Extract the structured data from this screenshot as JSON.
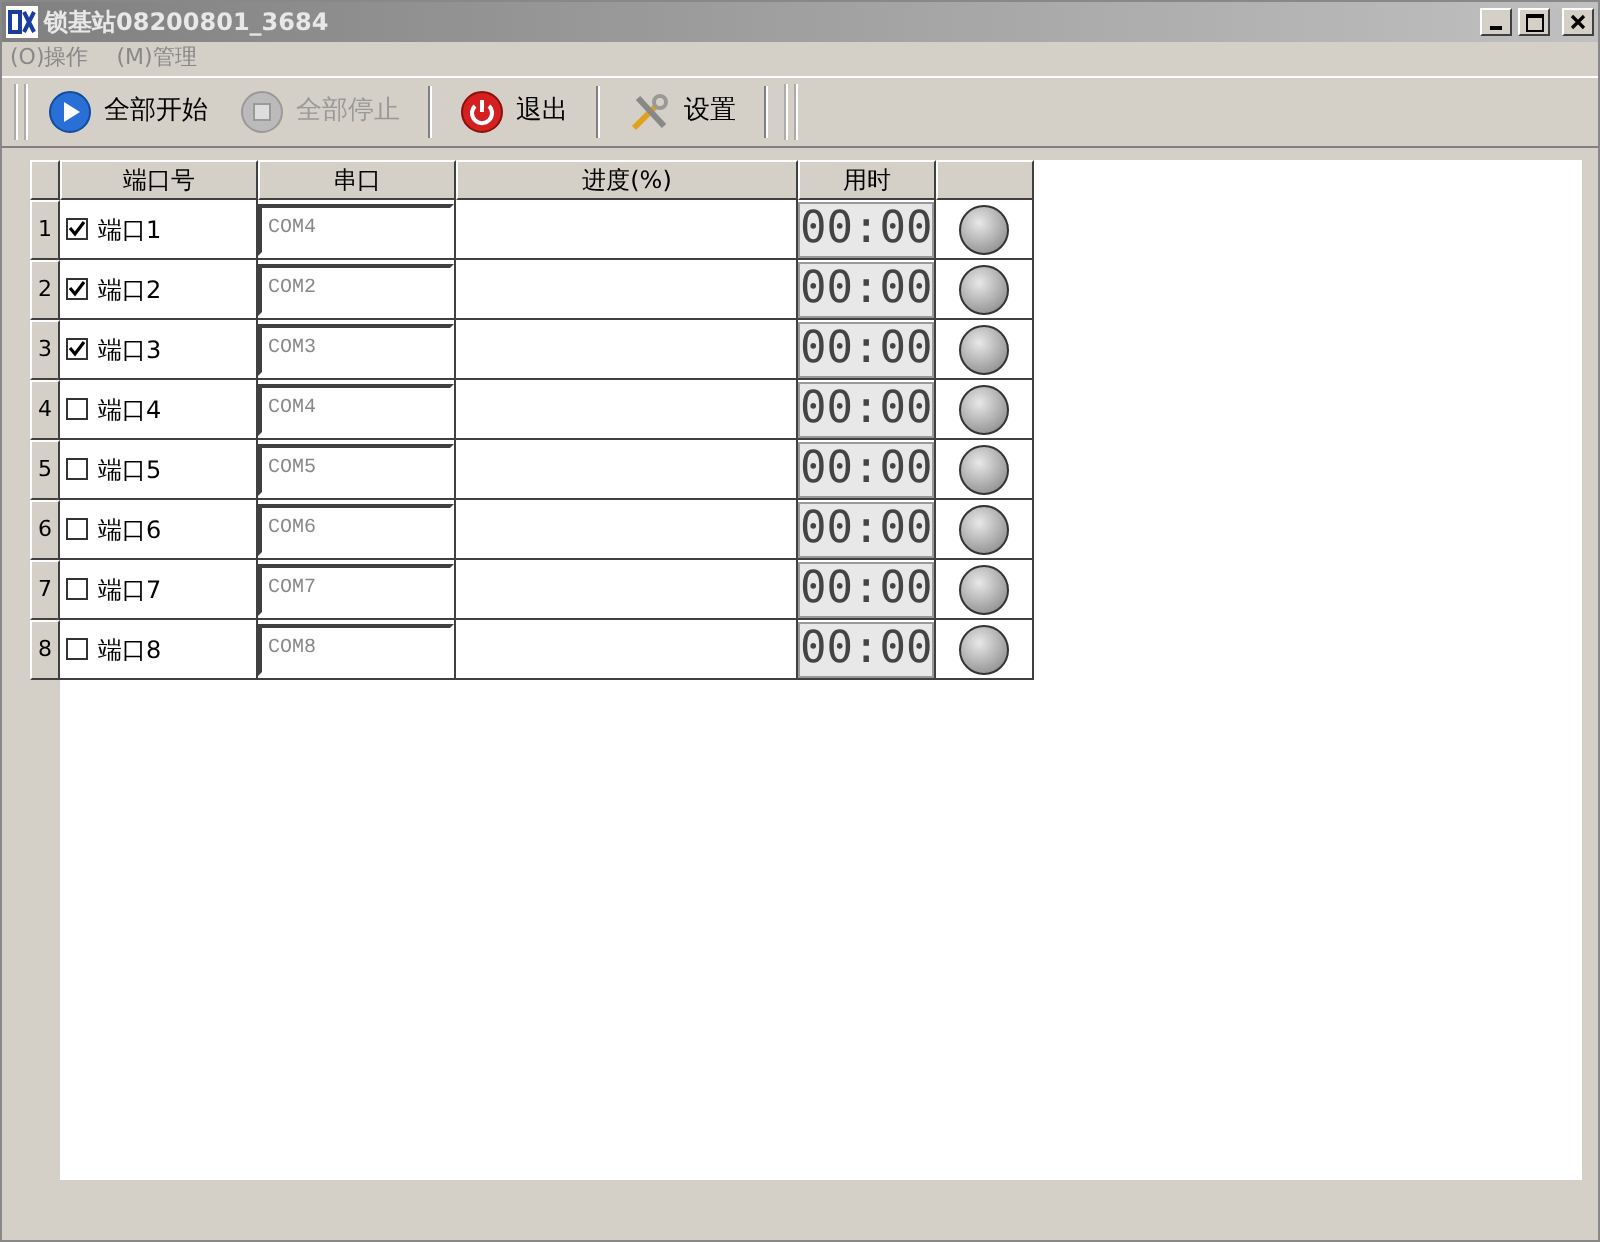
{
  "window": {
    "title": "锁基站08200801_3684"
  },
  "menu": [
    "(O)操作",
    "(M)管理"
  ],
  "toolbar": [
    {
      "kind": "play",
      "label": "全部开始",
      "disabled": false
    },
    {
      "kind": "stop",
      "label": "全部停止",
      "disabled": true
    },
    {
      "kind": "power",
      "label": "退出",
      "disabled": false
    },
    {
      "kind": "tools",
      "label": "设置",
      "disabled": false
    }
  ],
  "table": {
    "columns": [
      "端口号",
      "串口",
      "进度(%)",
      "用时"
    ],
    "rows": [
      {
        "index": "1",
        "port": "端口1",
        "checked": true,
        "serial": "COM4",
        "time": "00:00"
      },
      {
        "index": "2",
        "port": "端口2",
        "checked": true,
        "serial": "COM2",
        "time": "00:00"
      },
      {
        "index": "3",
        "port": "端口3",
        "checked": true,
        "serial": "COM3",
        "time": "00:00"
      },
      {
        "index": "4",
        "port": "端口4",
        "checked": false,
        "serial": "COM4",
        "time": "00:00"
      },
      {
        "index": "5",
        "port": "端口5",
        "checked": false,
        "serial": "COM5",
        "time": "00:00"
      },
      {
        "index": "6",
        "port": "端口6",
        "checked": false,
        "serial": "COM6",
        "time": "00:00"
      },
      {
        "index": "7",
        "port": "端口7",
        "checked": false,
        "serial": "COM7",
        "time": "00:00"
      },
      {
        "index": "8",
        "port": "端口8",
        "checked": false,
        "serial": "COM8",
        "time": "00:00"
      }
    ]
  }
}
